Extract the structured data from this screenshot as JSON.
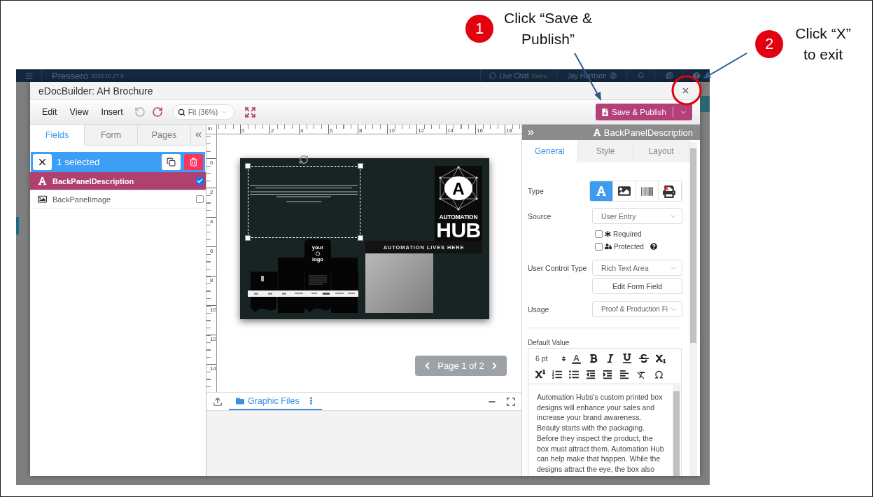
{
  "annotations": [
    {
      "number": "1",
      "text": "Click “Save & Publish”"
    },
    {
      "number": "2",
      "text": "Click “X” to exit"
    }
  ],
  "background_app": {
    "brand": "Pressero",
    "version": "2020.10.27.5",
    "chat": "Live Chat",
    "chat_status": "Online",
    "user": "Jay Harrison"
  },
  "window": {
    "title": "eDocBuilder: AH Brochure"
  },
  "toolbar": {
    "menus": [
      "Edit",
      "View",
      "Insert"
    ],
    "undo": {
      "disabled": true
    },
    "redo": {
      "disabled": false
    },
    "zoom": "Fit (36%)",
    "save_button": "Save & Publish"
  },
  "fields_panel": {
    "tabs": [
      {
        "label": "Fields",
        "selected": true
      },
      {
        "label": "Form",
        "selected": false
      },
      {
        "label": "Pages",
        "selected": false
      }
    ],
    "selection": "1 selected",
    "fields": [
      {
        "name": "BackPanelDescription",
        "kind": "text",
        "selected": true,
        "checked": true
      },
      {
        "name": "BackPanelImage",
        "kind": "image",
        "selected": false,
        "checked": false
      }
    ]
  },
  "canvas": {
    "ruler_unit": "in",
    "top_ruler": [
      "0",
      "2",
      "4",
      "6",
      "8",
      "10",
      "12",
      "14",
      "16",
      "18"
    ],
    "left_ruler": [
      "0",
      "2",
      "4",
      "6",
      "8",
      "10",
      "12",
      "14"
    ],
    "document": {
      "box_logo": [
        "your",
        "logo"
      ],
      "logo_letter": "A",
      "logo_title": "AUTOMATION",
      "logo_name": "HUB",
      "tagline": "AUTOMATION LIVES HERE"
    },
    "pager": "Page 1 of 2"
  },
  "bottom_panel": {
    "tabs": [
      {
        "label": "Graphic Files",
        "selected": true
      }
    ]
  },
  "properties": {
    "title": "BackPanelDescription",
    "tabs": [
      {
        "label": "General",
        "selected": true
      },
      {
        "label": "Style",
        "selected": false
      },
      {
        "label": "Layout",
        "selected": false
      }
    ],
    "type": {
      "label": "Type",
      "options": [
        {
          "kind": "text",
          "selected": true
        },
        {
          "kind": "image",
          "selected": false
        },
        {
          "kind": "barcode",
          "selected": false
        },
        {
          "kind": "no-print",
          "selected": false
        }
      ]
    },
    "source": {
      "label": "Source",
      "value": "User Entry"
    },
    "flags": [
      {
        "kind": "required",
        "label": "Required",
        "checked": false
      },
      {
        "kind": "protected",
        "label": "Protected",
        "checked": false
      }
    ],
    "control_type": {
      "label": "User Control Type",
      "value": "Rich Text Area"
    },
    "edit_button": "Edit Form Field",
    "usage": {
      "label": "Usage",
      "value": "Proof & Production Fi"
    },
    "default_value": {
      "label": "Default Value",
      "font_size": "6 pt",
      "text": "Automation Hubs's custom printed box designs will enhance your sales and increase your brand awareness. Beauty starts with the packaging. Before they inspect the product, the box must attract them. Automation Hub can help make that happen. While the designs attract the eye, the box also"
    }
  }
}
